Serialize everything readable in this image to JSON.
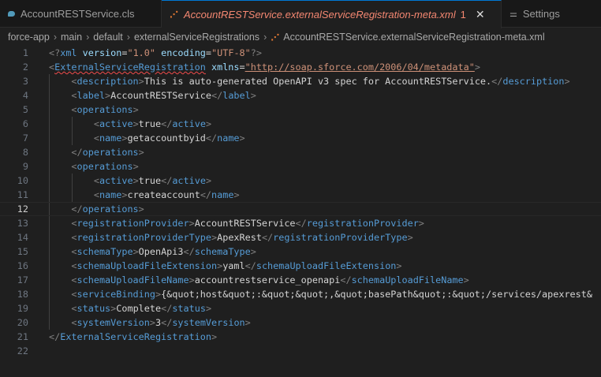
{
  "tabs": [
    {
      "label": "AccountRESTService.cls",
      "icon": "salesforce-cls-icon"
    },
    {
      "label": "AccountRESTService.externalServiceRegistration-meta.xml",
      "icon": "rss-xml-icon",
      "badge": "1",
      "active": true
    },
    {
      "label": "Settings",
      "icon": "settings-sliders-icon"
    }
  ],
  "breadcrumb": [
    "force-app",
    "main",
    "default",
    "externalServiceRegistrations",
    "AccountRESTService.externalServiceRegistration-meta.xml"
  ],
  "current_line": 12,
  "lines": [
    [
      [
        "p",
        "<?"
      ],
      [
        "t",
        "xml"
      ],
      [
        "x",
        " "
      ],
      [
        "a",
        "version"
      ],
      [
        "x",
        "="
      ],
      [
        "s",
        "\"1.0\""
      ],
      [
        "x",
        " "
      ],
      [
        "a",
        "encoding"
      ],
      [
        "x",
        "="
      ],
      [
        "s",
        "\"UTF-8\""
      ],
      [
        "p",
        "?>"
      ]
    ],
    [
      [
        "p",
        "<"
      ],
      [
        "t",
        "ExternalServiceRegistration",
        "sq"
      ],
      [
        "x",
        " "
      ],
      [
        "a",
        "xmlns"
      ],
      [
        "x",
        "="
      ],
      [
        "s",
        "\"http://soap.sforce.com/2006/04/metadata\"",
        "ul"
      ],
      [
        "p",
        ">"
      ]
    ],
    [
      [
        "x",
        "    "
      ],
      [
        "p",
        "<"
      ],
      [
        "t",
        "description"
      ],
      [
        "p",
        ">"
      ],
      [
        "x",
        "This is auto-generated OpenAPI v3 spec for AccountRESTService."
      ],
      [
        "p",
        "</"
      ],
      [
        "t",
        "description"
      ],
      [
        "p",
        ">"
      ]
    ],
    [
      [
        "x",
        "    "
      ],
      [
        "p",
        "<"
      ],
      [
        "t",
        "label"
      ],
      [
        "p",
        ">"
      ],
      [
        "x",
        "AccountRESTService"
      ],
      [
        "p",
        "</"
      ],
      [
        "t",
        "label"
      ],
      [
        "p",
        ">"
      ]
    ],
    [
      [
        "x",
        "    "
      ],
      [
        "p",
        "<"
      ],
      [
        "t",
        "operations"
      ],
      [
        "p",
        ">"
      ]
    ],
    [
      [
        "x",
        "        "
      ],
      [
        "p",
        "<"
      ],
      [
        "t",
        "active"
      ],
      [
        "p",
        ">"
      ],
      [
        "x",
        "true"
      ],
      [
        "p",
        "</"
      ],
      [
        "t",
        "active"
      ],
      [
        "p",
        ">"
      ]
    ],
    [
      [
        "x",
        "        "
      ],
      [
        "p",
        "<"
      ],
      [
        "t",
        "name"
      ],
      [
        "p",
        ">"
      ],
      [
        "x",
        "getaccountbyid"
      ],
      [
        "p",
        "</"
      ],
      [
        "t",
        "name"
      ],
      [
        "p",
        ">"
      ]
    ],
    [
      [
        "x",
        "    "
      ],
      [
        "p",
        "</"
      ],
      [
        "t",
        "operations"
      ],
      [
        "p",
        ">"
      ]
    ],
    [
      [
        "x",
        "    "
      ],
      [
        "p",
        "<"
      ],
      [
        "t",
        "operations"
      ],
      [
        "p",
        ">"
      ]
    ],
    [
      [
        "x",
        "        "
      ],
      [
        "p",
        "<"
      ],
      [
        "t",
        "active"
      ],
      [
        "p",
        ">"
      ],
      [
        "x",
        "true"
      ],
      [
        "p",
        "</"
      ],
      [
        "t",
        "active"
      ],
      [
        "p",
        ">"
      ]
    ],
    [
      [
        "x",
        "        "
      ],
      [
        "p",
        "<"
      ],
      [
        "t",
        "name"
      ],
      [
        "p",
        ">"
      ],
      [
        "x",
        "createaccount"
      ],
      [
        "p",
        "</"
      ],
      [
        "t",
        "name"
      ],
      [
        "p",
        ">"
      ]
    ],
    [
      [
        "x",
        "    "
      ],
      [
        "p",
        "</"
      ],
      [
        "t",
        "operations"
      ],
      [
        "p",
        ">"
      ]
    ],
    [
      [
        "x",
        "    "
      ],
      [
        "p",
        "<"
      ],
      [
        "t",
        "registrationProvider"
      ],
      [
        "p",
        ">"
      ],
      [
        "x",
        "AccountRESTService"
      ],
      [
        "p",
        "</"
      ],
      [
        "t",
        "registrationProvider"
      ],
      [
        "p",
        ">"
      ]
    ],
    [
      [
        "x",
        "    "
      ],
      [
        "p",
        "<"
      ],
      [
        "t",
        "registrationProviderType"
      ],
      [
        "p",
        ">"
      ],
      [
        "x",
        "ApexRest"
      ],
      [
        "p",
        "</"
      ],
      [
        "t",
        "registrationProviderType"
      ],
      [
        "p",
        ">"
      ]
    ],
    [
      [
        "x",
        "    "
      ],
      [
        "p",
        "<"
      ],
      [
        "t",
        "schemaType"
      ],
      [
        "p",
        ">"
      ],
      [
        "x",
        "OpenApi3"
      ],
      [
        "p",
        "</"
      ],
      [
        "t",
        "schemaType"
      ],
      [
        "p",
        ">"
      ]
    ],
    [
      [
        "x",
        "    "
      ],
      [
        "p",
        "<"
      ],
      [
        "t",
        "schemaUploadFileExtension"
      ],
      [
        "p",
        ">"
      ],
      [
        "x",
        "yaml"
      ],
      [
        "p",
        "</"
      ],
      [
        "t",
        "schemaUploadFileExtension"
      ],
      [
        "p",
        ">"
      ]
    ],
    [
      [
        "x",
        "    "
      ],
      [
        "p",
        "<"
      ],
      [
        "t",
        "schemaUploadFileName"
      ],
      [
        "p",
        ">"
      ],
      [
        "x",
        "accountrestservice_openapi"
      ],
      [
        "p",
        "</"
      ],
      [
        "t",
        "schemaUploadFileName"
      ],
      [
        "p",
        ">"
      ]
    ],
    [
      [
        "x",
        "    "
      ],
      [
        "p",
        "<"
      ],
      [
        "t",
        "serviceBinding"
      ],
      [
        "p",
        ">"
      ],
      [
        "x",
        "{&quot;host&quot;:&quot;&quot;,&quot;basePath&quot;:&quot;/services/apexrest&"
      ]
    ],
    [
      [
        "x",
        "    "
      ],
      [
        "p",
        "<"
      ],
      [
        "t",
        "status"
      ],
      [
        "p",
        ">"
      ],
      [
        "x",
        "Complete"
      ],
      [
        "p",
        "</"
      ],
      [
        "t",
        "status"
      ],
      [
        "p",
        ">"
      ]
    ],
    [
      [
        "x",
        "    "
      ],
      [
        "p",
        "<"
      ],
      [
        "t",
        "systemVersion"
      ],
      [
        "p",
        ">"
      ],
      [
        "x",
        "3"
      ],
      [
        "p",
        "</"
      ],
      [
        "t",
        "systemVersion"
      ],
      [
        "p",
        ">"
      ]
    ],
    [
      [
        "p",
        "</"
      ],
      [
        "t",
        "ExternalServiceRegistration"
      ],
      [
        "p",
        ">"
      ]
    ],
    []
  ]
}
